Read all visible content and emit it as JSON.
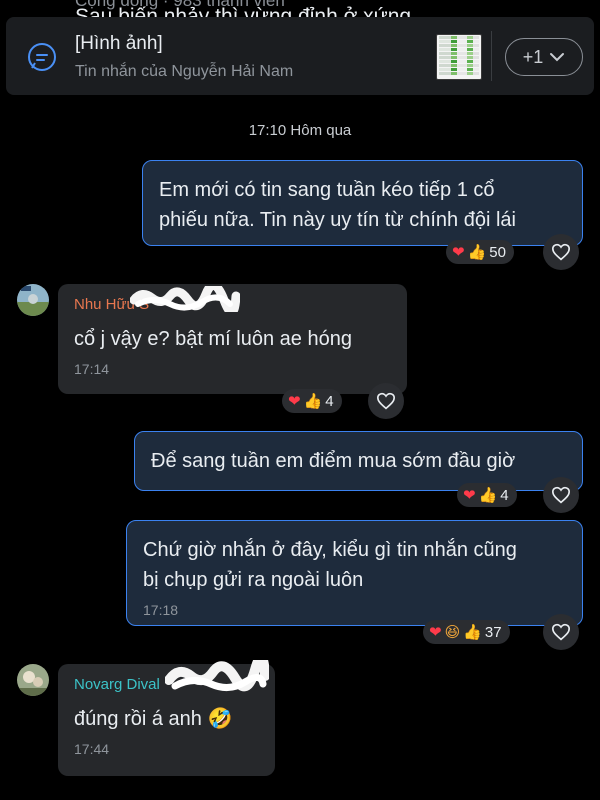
{
  "header": {
    "subtitle_cut": "Cộng đồng · 983 thành viên",
    "title_cut": "Sau biến nhảy thì vừng đỉnh ở xứng"
  },
  "pinned": {
    "title": "[Hình ảnh]",
    "subtitle": "Tin nhắn của Nguyễn Hải Nam",
    "more_label": "+1",
    "icon": "chat-bubble-icon"
  },
  "time_separator": "17:10 Hôm qua",
  "messages": [
    {
      "direction": "out",
      "text": "Em mới có tin sang tuần kéo tiếp 1 cổ\nphiếu nữa. Tin này uy tín từ chính đội lái",
      "reactions": {
        "icons": [
          "heart",
          "thumbs-up"
        ],
        "count": "50"
      }
    },
    {
      "direction": "in",
      "sender": "Nhu Hữu S",
      "sender_color": "#e8774f",
      "text": "cổ j vậy e? bật mí luôn ae hóng",
      "time": "17:14",
      "reactions": {
        "icons": [
          "heart",
          "thumbs-up"
        ],
        "count": "4"
      }
    },
    {
      "direction": "out",
      "text": "Để sang tuần em điểm mua sớm đầu giờ",
      "reactions": {
        "icons": [
          "heart",
          "thumbs-up"
        ],
        "count": "4"
      }
    },
    {
      "direction": "out",
      "text": "Chứ giờ nhắn ở đây, kiểu gì tin nhắn cũng\nbị chụp gửi ra ngoài luôn",
      "time": "17:18",
      "reactions": {
        "icons": [
          "heart",
          "laugh",
          "thumbs-up"
        ],
        "count": "37"
      }
    },
    {
      "direction": "in",
      "sender": "Novarg Dival",
      "sender_color": "#3cc3c8",
      "text": "đúng rồi á anh 🤣",
      "time": "17:44"
    }
  ],
  "colors": {
    "outgoing_border": "#3b82f0",
    "outgoing_bg": "#1e2b3c",
    "incoming_bg": "#26282b",
    "background": "#000000"
  }
}
